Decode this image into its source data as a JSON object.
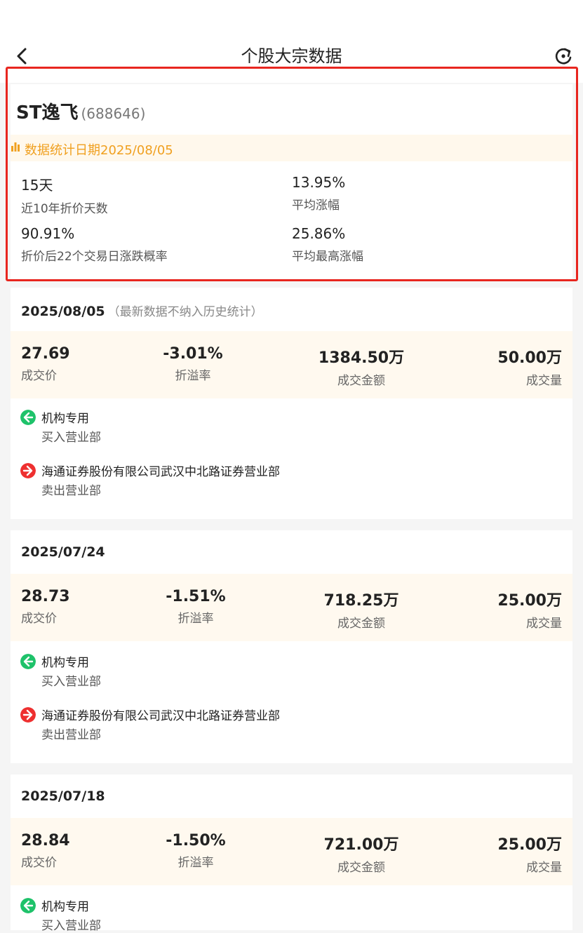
{
  "header": {
    "title": "个股大宗数据",
    "back_icon": "chevron-left-icon",
    "refresh_icon": "refresh-icon"
  },
  "summary": {
    "stock_name": "ST逸飞",
    "stock_code": "(688646)",
    "date_label": "数据统计日期2025/08/05",
    "metrics": [
      {
        "value": "15天",
        "label": "近10年折价天数"
      },
      {
        "value": "13.95%",
        "label": "平均涨幅"
      },
      {
        "value": "90.91%",
        "label": "折价后22个交易日涨跌概率"
      },
      {
        "value": "25.86%",
        "label": "平均最高涨幅"
      }
    ]
  },
  "trades": [
    {
      "date": "2025/08/05",
      "note": "（最新数据不纳入历史统计）",
      "price": {
        "value": "27.69",
        "label": "成交价"
      },
      "premium": {
        "value": "-3.01%",
        "label": "折溢率"
      },
      "amount": {
        "value": "1384.50万",
        "label": "成交金额"
      },
      "volume": {
        "value": "50.00万",
        "label": "成交量"
      },
      "buyer": {
        "name": "机构专用",
        "role": "买入营业部"
      },
      "seller": {
        "name": "海通证券股份有限公司武汉中北路证券营业部",
        "role": "卖出营业部"
      }
    },
    {
      "date": "2025/07/24",
      "note": "",
      "price": {
        "value": "28.73",
        "label": "成交价"
      },
      "premium": {
        "value": "-1.51%",
        "label": "折溢率"
      },
      "amount": {
        "value": "718.25万",
        "label": "成交金额"
      },
      "volume": {
        "value": "25.00万",
        "label": "成交量"
      },
      "buyer": {
        "name": "机构专用",
        "role": "买入营业部"
      },
      "seller": {
        "name": "海通证券股份有限公司武汉中北路证券营业部",
        "role": "卖出营业部"
      }
    },
    {
      "date": "2025/07/18",
      "note": "",
      "price": {
        "value": "28.84",
        "label": "成交价"
      },
      "premium": {
        "value": "-1.50%",
        "label": "折溢率"
      },
      "amount": {
        "value": "721.00万",
        "label": "成交金额"
      },
      "volume": {
        "value": "25.00万",
        "label": "成交量"
      },
      "buyer": {
        "name": "机构专用",
        "role": "买入营业部"
      }
    }
  ],
  "colors": {
    "highlight_border": "#e8261f",
    "buy_icon": "#1ec26a",
    "sell_icon": "#ee3030",
    "date_bar_text": "#f0a020",
    "stats_background": "#fff9ef"
  }
}
